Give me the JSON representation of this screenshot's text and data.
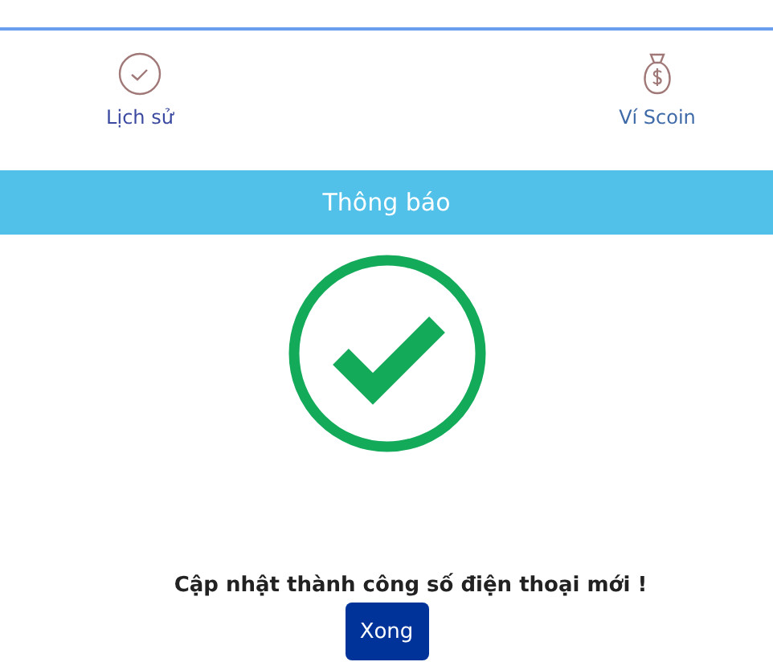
{
  "nav": [
    {
      "kind": "history",
      "label": "Lịch sử"
    },
    {
      "kind": "wallet",
      "label": "Ví Scoin"
    }
  ],
  "banner": {
    "title": "Thông báo"
  },
  "message": "Cập nhật thành công số điện thoại mới !",
  "button": "Xong"
}
